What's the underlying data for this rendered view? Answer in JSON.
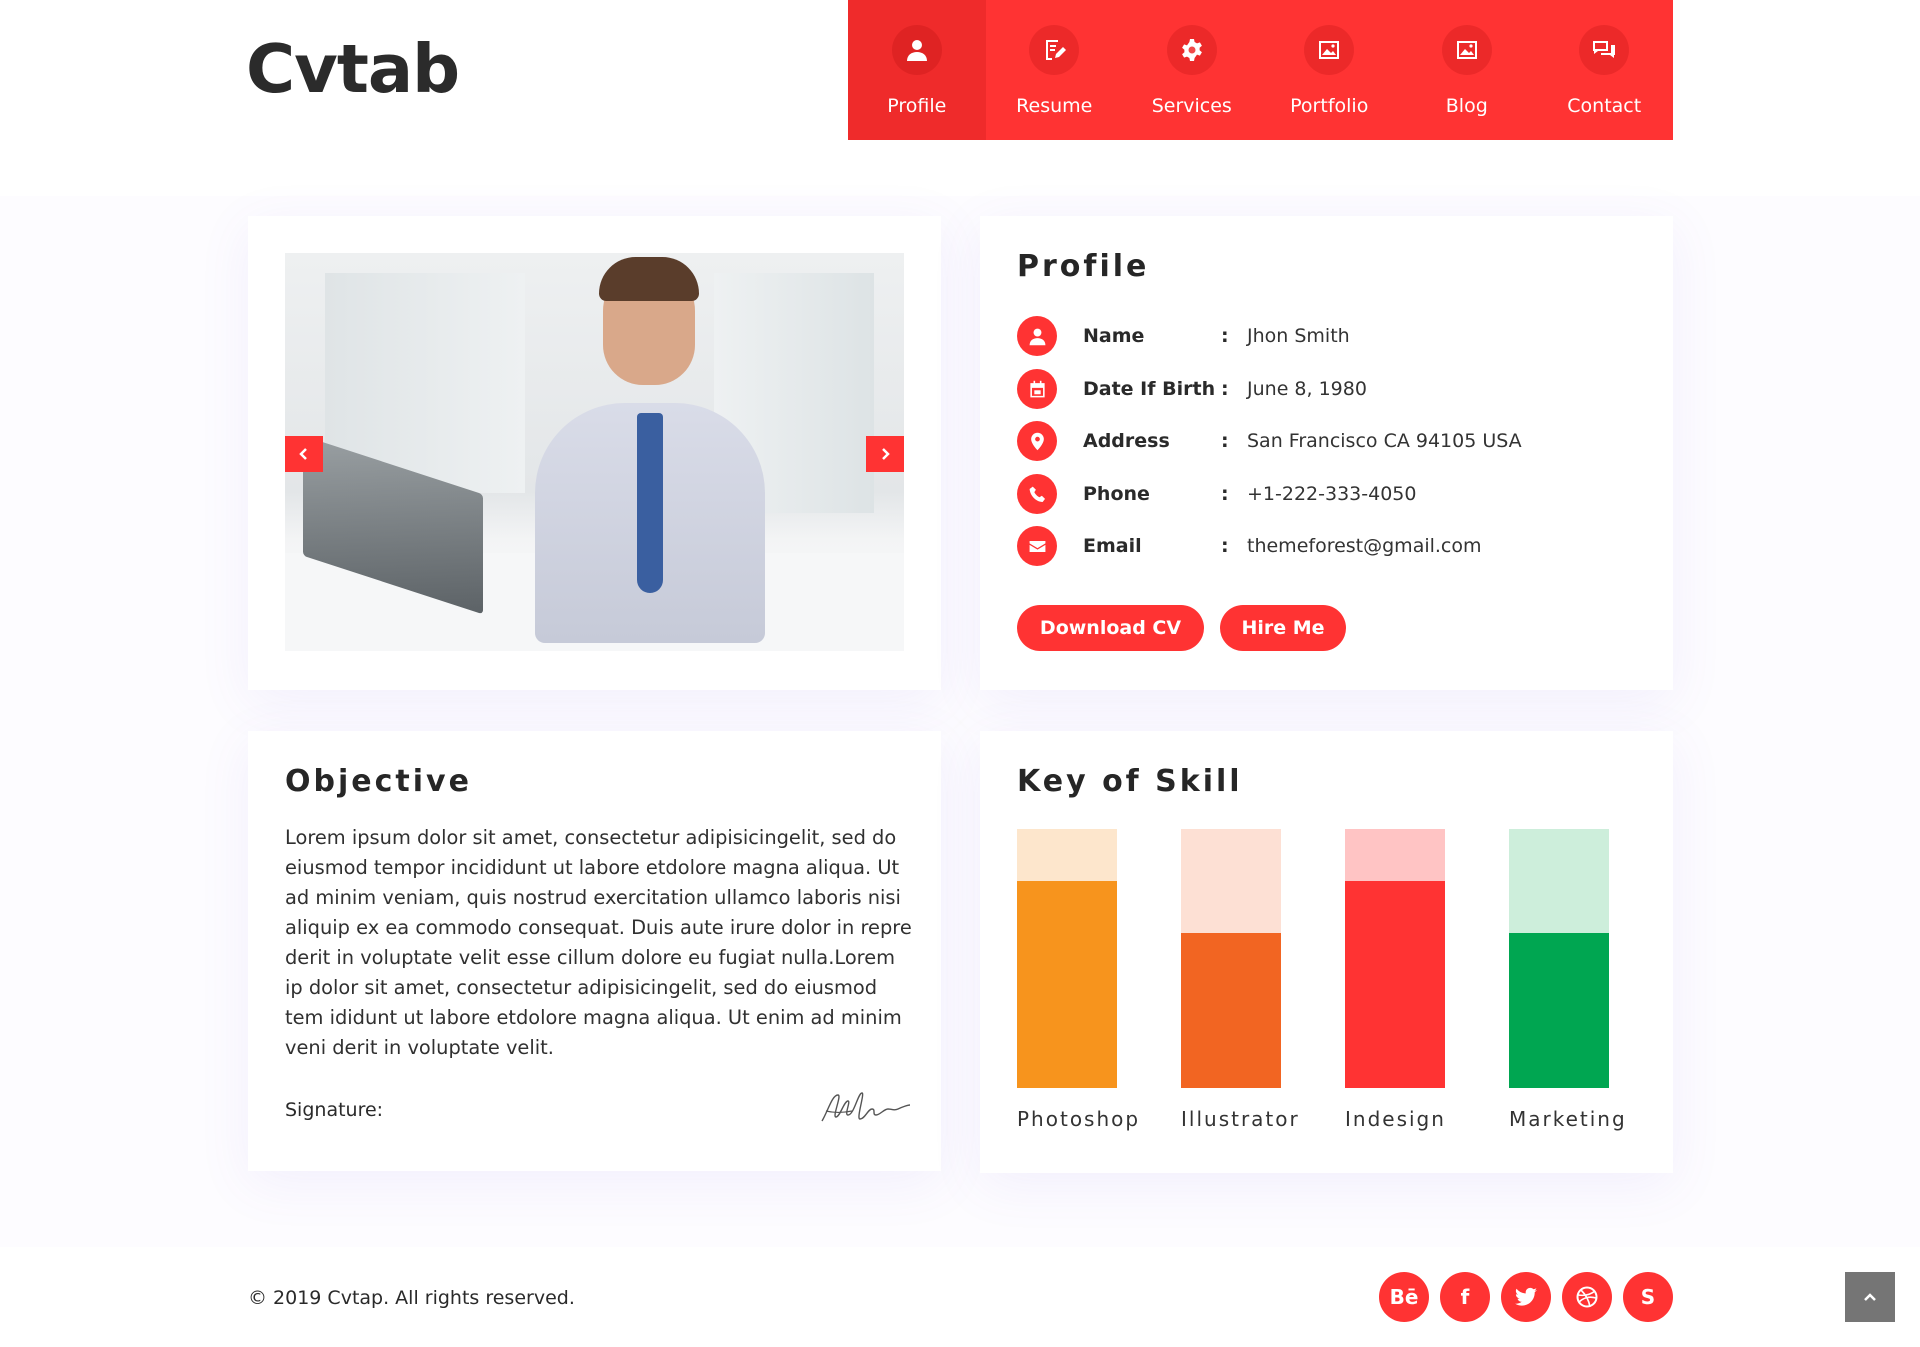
{
  "brand": {
    "logo": "Cvtab"
  },
  "nav": {
    "items": [
      {
        "label": "Profile",
        "icon": "user-icon",
        "active": true
      },
      {
        "label": "Resume",
        "icon": "document-edit-icon",
        "active": false
      },
      {
        "label": "Services",
        "icon": "gear-icon",
        "active": false
      },
      {
        "label": "Portfolio",
        "icon": "image-icon",
        "active": false
      },
      {
        "label": "Blog",
        "icon": "image-icon",
        "active": false
      },
      {
        "label": "Contact",
        "icon": "chat-icon",
        "active": false
      }
    ]
  },
  "profile": {
    "title": "Profile",
    "rows": [
      {
        "key": "Name",
        "sep": ":",
        "value": "Jhon Smith",
        "icon": "user-icon"
      },
      {
        "key": "Date If Birth",
        "sep": ":",
        "value": "June 8, 1980",
        "icon": "calendar-icon"
      },
      {
        "key": "Address",
        "sep": ":",
        "value": "San Francisco CA 94105 USA",
        "icon": "location-pin-icon"
      },
      {
        "key": "Phone",
        "sep": ":",
        "value": "+1-222-333-4050",
        "icon": "phone-icon"
      },
      {
        "key": "Email",
        "sep": ":",
        "value": "themeforest@gmail.com",
        "icon": "envelope-icon"
      }
    ],
    "download_label": "Download CV",
    "hire_label": "Hire Me"
  },
  "objective": {
    "title": "Objective",
    "text": "Lorem ipsum dolor sit amet, consectetur adipisicingelit, sed do eiusmod tempor incididunt ut labore etdolore magna aliqua. Ut ad minim veniam, quis nostrud exercitation ullamco laboris nisi aliquip ex ea commodo consequat. Duis aute irure dolor in repre derit in voluptate velit esse cillum dolore eu fugiat nulla.Lorem ip dolor sit amet, consectetur adipisicingelit, sed do eiusmod tem ididunt ut labore etdolore magna aliqua. Ut enim ad minim veni derit in voluptate velit.",
    "signature_label": "Signature:"
  },
  "skills": {
    "title": "Key of Skill",
    "items": [
      {
        "label": "Photoshop",
        "level": 0.8,
        "color": "#f7941d",
        "track": "#fde6cc"
      },
      {
        "label": "Illustrator",
        "level": 0.6,
        "color": "#f26522",
        "track": "#fde0d4"
      },
      {
        "label": "Indesign",
        "level": 0.8,
        "color": "#ff3333",
        "track": "#ffc4c4"
      },
      {
        "label": "Marketing",
        "level": 0.6,
        "color": "#00a651",
        "track": "#cdeedb"
      }
    ]
  },
  "footer": {
    "copyright": "© 2019 Cvtap. All rights reserved.",
    "social": [
      {
        "name": "behance-icon",
        "glyph": "Bē"
      },
      {
        "name": "facebook-icon",
        "glyph": "f"
      },
      {
        "name": "twitter-icon",
        "glyph": ""
      },
      {
        "name": "dribbble-icon",
        "glyph": ""
      },
      {
        "name": "skype-icon",
        "glyph": "S"
      }
    ]
  },
  "colors": {
    "accent": "#ff3333",
    "accent_dark": "#ef2b2b",
    "to_top": "#757575"
  }
}
